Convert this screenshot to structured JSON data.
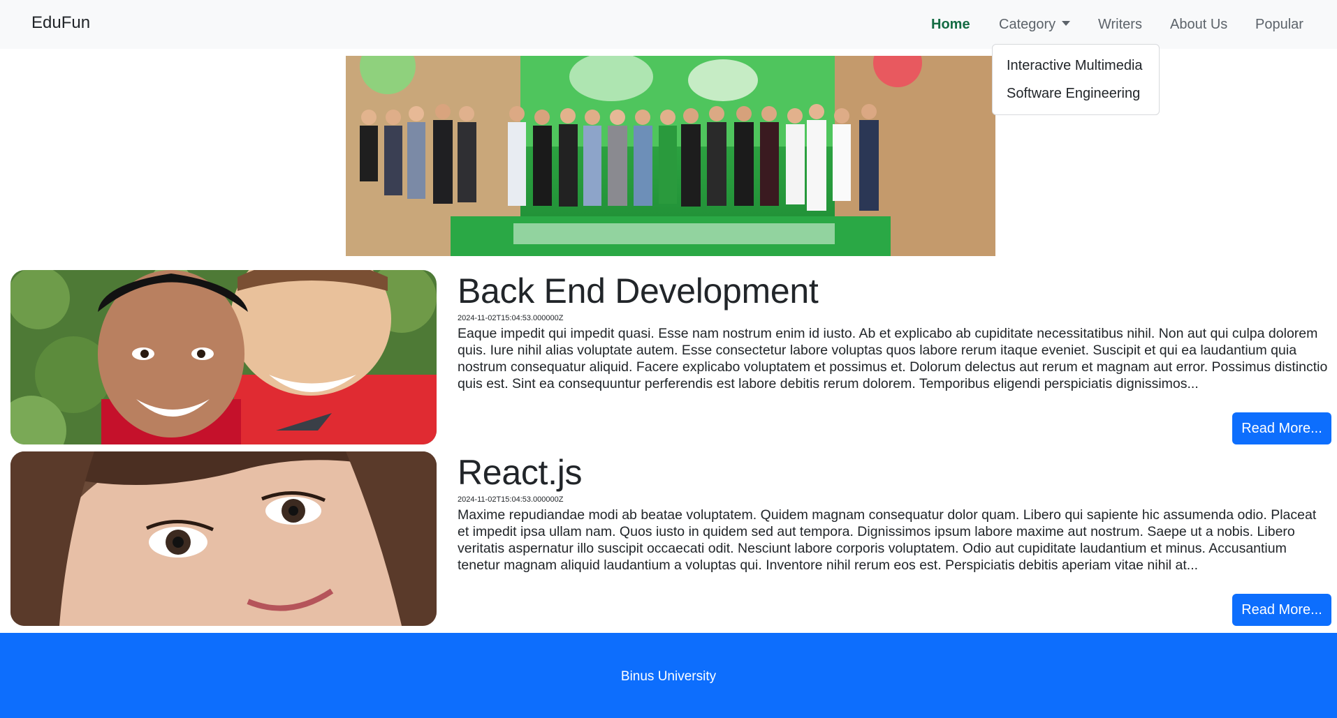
{
  "navbar": {
    "brand": "EduFun",
    "items": [
      {
        "label": "Home"
      },
      {
        "label": "Category"
      },
      {
        "label": "Writers"
      },
      {
        "label": "About Us"
      },
      {
        "label": "Popular"
      }
    ],
    "category_dropdown": [
      "Interactive Multimedia",
      "Software Engineering"
    ]
  },
  "articles": [
    {
      "title": "Back End Development",
      "date": "2024-11-02T15:04:53.000000Z",
      "body": "Eaque impedit qui impedit quasi. Esse nam nostrum enim id iusto. Ab et explicabo ab cupiditate necessitatibus nihil. Non aut qui culpa dolorem quis. Iure nihil alias voluptate autem. Esse consectetur labore voluptas quos labore rerum itaque eveniet. Suscipit et qui ea laudantium quia nostrum consequatur aliquid. Facere explicabo voluptatem et possimus et. Dolorum delectus aut rerum et magnam aut error. Possimus distinctio quis est. Sint ea consequuntur perferendis est labore debitis rerum dolorem. Temporibus eligendi perspiciatis dignissimos...",
      "button": "Read More..."
    },
    {
      "title": "React.js",
      "date": "2024-11-02T15:04:53.000000Z",
      "body": "Maxime repudiandae modi ab beatae voluptatem. Quidem magnam consequatur dolor quam. Libero qui sapiente hic assumenda odio. Placeat et impedit ipsa ullam nam. Quos iusto in quidem sed aut tempora. Dignissimos ipsum labore maxime aut nostrum. Saepe ut a nobis. Libero veritatis aspernatur illo suscipit occaecati odit. Nesciunt labore corporis voluptatem. Odio aut cupiditate laudantium et minus. Accusantium tenetur magnam aliquid laudantium a voluptas qui. Inventore nihil rerum eos est. Perspiciatis debitis aperiam vitae nihil at...",
      "button": "Read More..."
    }
  ],
  "footer": {
    "text": "Binus University"
  },
  "colors": {
    "primary": "#0d6efd",
    "nav_bg": "#f8f9fa",
    "active_nav": "#146c43"
  }
}
